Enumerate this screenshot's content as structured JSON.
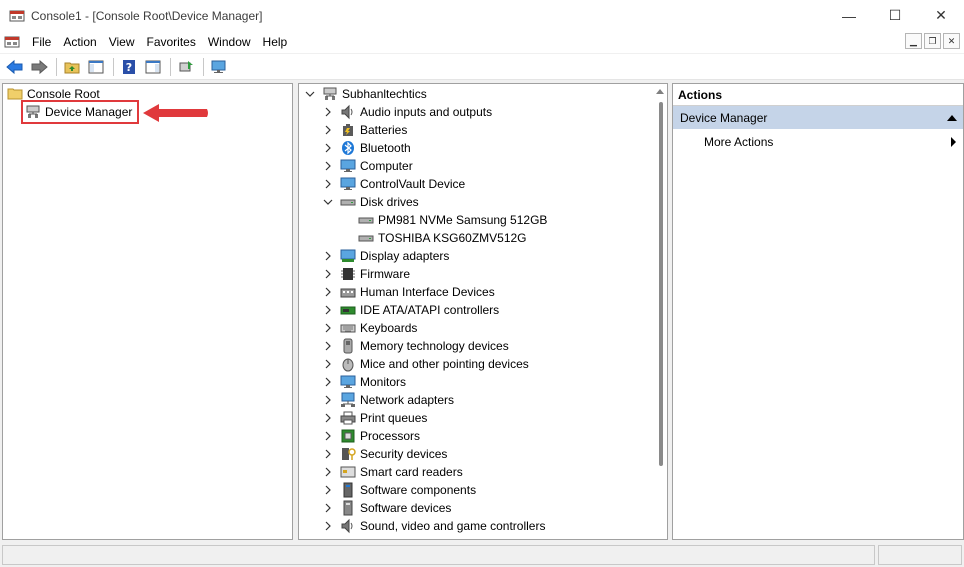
{
  "window": {
    "title": "Console1 - [Console Root\\Device Manager]",
    "minimize_glyph": "—",
    "maximize_glyph": "☐",
    "close_glyph": "✕"
  },
  "menu": {
    "items": [
      "File",
      "Action",
      "View",
      "Favorites",
      "Window",
      "Help"
    ],
    "mdi": [
      "▁",
      "❐",
      "✕"
    ]
  },
  "left_tree": {
    "root": "Console Root",
    "child": "Device Manager"
  },
  "device_tree": {
    "computer": "Subhanltechtics",
    "categories": [
      {
        "label": "Audio inputs and outputs",
        "icon": "speaker-icon",
        "expanded": false
      },
      {
        "label": "Batteries",
        "icon": "battery-icon",
        "expanded": false
      },
      {
        "label": "Bluetooth",
        "icon": "bluetooth-icon",
        "expanded": false
      },
      {
        "label": "Computer",
        "icon": "monitor-icon",
        "expanded": false
      },
      {
        "label": "ControlVault Device",
        "icon": "monitor-icon",
        "expanded": false
      },
      {
        "label": "Disk drives",
        "icon": "disk-drive-icon",
        "expanded": true,
        "children": [
          "PM981 NVMe Samsung 512GB",
          "TOSHIBA KSG60ZMV512G"
        ]
      },
      {
        "label": "Display adapters",
        "icon": "display-adapter-icon",
        "expanded": false
      },
      {
        "label": "Firmware",
        "icon": "firmware-icon",
        "expanded": false
      },
      {
        "label": "Human Interface Devices",
        "icon": "hid-icon",
        "expanded": false
      },
      {
        "label": "IDE ATA/ATAPI controllers",
        "icon": "ide-controller-icon",
        "expanded": false
      },
      {
        "label": "Keyboards",
        "icon": "keyboard-icon",
        "expanded": false
      },
      {
        "label": "Memory technology devices",
        "icon": "memory-icon",
        "expanded": false
      },
      {
        "label": "Mice and other pointing devices",
        "icon": "mouse-icon",
        "expanded": false
      },
      {
        "label": "Monitors",
        "icon": "monitor-icon",
        "expanded": false
      },
      {
        "label": "Network adapters",
        "icon": "network-icon",
        "expanded": false
      },
      {
        "label": "Print queues",
        "icon": "printer-icon",
        "expanded": false
      },
      {
        "label": "Processors",
        "icon": "processor-icon",
        "expanded": false
      },
      {
        "label": "Security devices",
        "icon": "security-icon",
        "expanded": false
      },
      {
        "label": "Smart card readers",
        "icon": "smart-card-icon",
        "expanded": false
      },
      {
        "label": "Software components",
        "icon": "software-component-icon",
        "expanded": false
      },
      {
        "label": "Software devices",
        "icon": "software-device-icon",
        "expanded": false
      },
      {
        "label": "Sound, video and game controllers",
        "icon": "speaker-icon",
        "expanded": false
      }
    ]
  },
  "actions": {
    "header": "Actions",
    "section": "Device Manager",
    "item": "More Actions"
  },
  "colors": {
    "highlight": "#e0393c",
    "actions_section_bg": "#c5d4e8",
    "folder": "#e8c35a",
    "accent_blue": "#1e78d7"
  }
}
